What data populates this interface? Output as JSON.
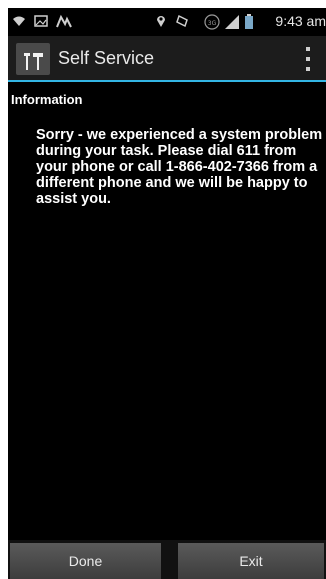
{
  "status_bar": {
    "time": "9:43 am",
    "icons": [
      "wifi-icon",
      "image-icon",
      "signal-icon",
      "location-icon",
      "sync-icon",
      "3g-icon",
      "network-icon",
      "battery-icon"
    ]
  },
  "action_bar": {
    "title": "Self Service",
    "icon": "tools-icon",
    "accent_color": "#33b5e5"
  },
  "content": {
    "section_title": "Information",
    "message": "Sorry - we experienced a system problem during your task. Please dial 611 from your phone or call 1-866-402-7366 from a different phone and we will be happy to assist you."
  },
  "buttons": {
    "done_label": "Done",
    "exit_label": "Exit"
  }
}
